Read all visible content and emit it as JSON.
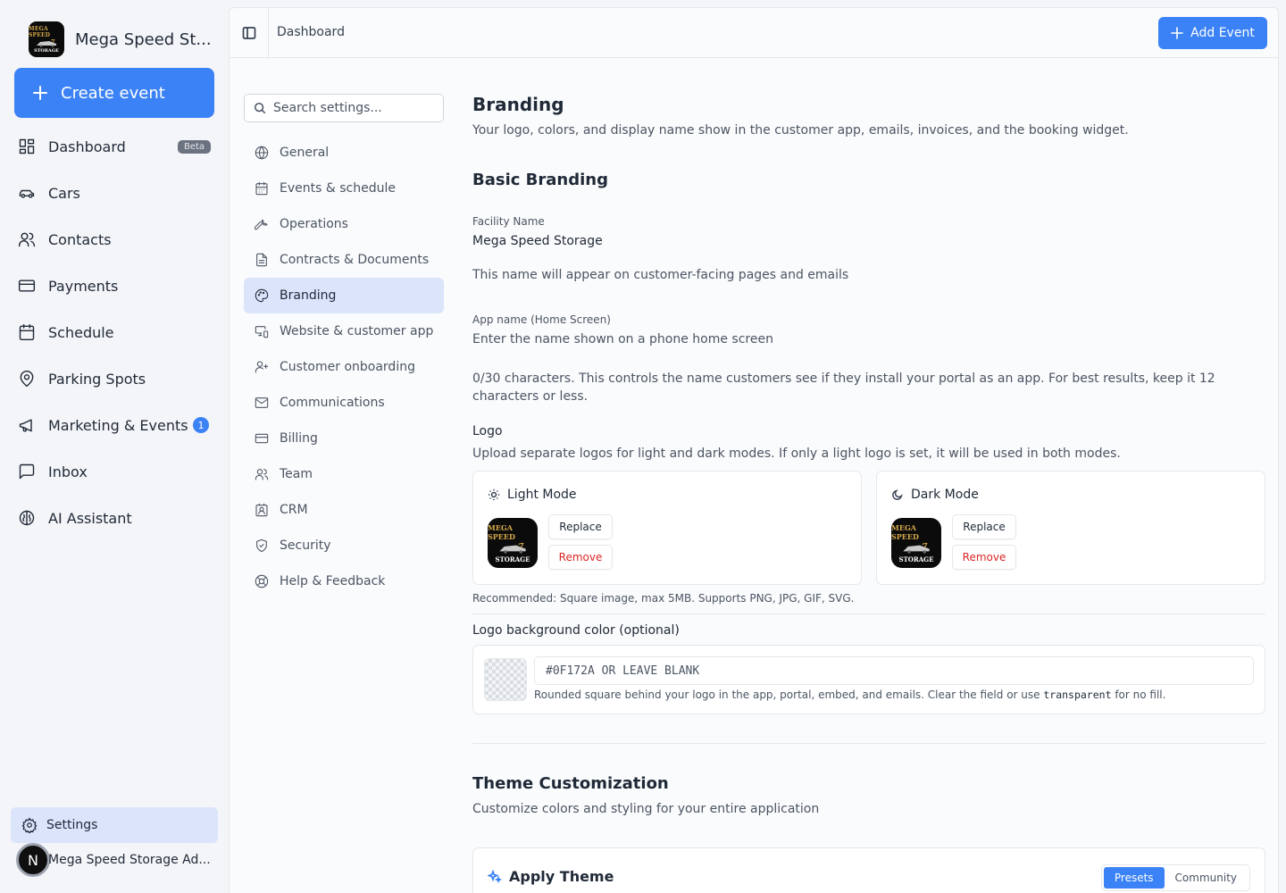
{
  "sidebar": {
    "brand_name": "Mega Speed St...",
    "logo_text_top": "MEGA SPEED",
    "logo_text_bottom": "STORAGE",
    "create_label": "Create event",
    "items": [
      {
        "label": "Dashboard",
        "icon": "layout-dashboard-icon",
        "badge": "Beta"
      },
      {
        "label": "Cars",
        "icon": "car-icon"
      },
      {
        "label": "Contacts",
        "icon": "users-icon"
      },
      {
        "label": "Payments",
        "icon": "credit-card-icon"
      },
      {
        "label": "Schedule",
        "icon": "calendar-icon"
      },
      {
        "label": "Parking Spots",
        "icon": "map-pin-icon"
      },
      {
        "label": "Marketing & Events",
        "icon": "megaphone-icon",
        "count": "1"
      },
      {
        "label": "Inbox",
        "icon": "message-square-icon"
      },
      {
        "label": "AI Assistant",
        "icon": "brain-icon"
      }
    ],
    "settings_label": "Settings",
    "user_initial": "N",
    "user_name": "Mega Speed Storage Ad..."
  },
  "topbar": {
    "breadcrumb": "Dashboard",
    "add_event_label": "Add Event"
  },
  "settings_nav": {
    "search_placeholder": "Search settings...",
    "items": [
      {
        "label": "General",
        "icon": "globe-icon"
      },
      {
        "label": "Events & schedule",
        "icon": "calendar-icon"
      },
      {
        "label": "Operations",
        "icon": "wrench-icon"
      },
      {
        "label": "Contracts & Documents",
        "icon": "file-text-icon"
      },
      {
        "label": "Branding",
        "icon": "palette-icon",
        "active": true
      },
      {
        "label": "Website & customer app",
        "icon": "monitor-smartphone-icon"
      },
      {
        "label": "Customer onboarding",
        "icon": "user-plus-icon"
      },
      {
        "label": "Communications",
        "icon": "mail-icon"
      },
      {
        "label": "Billing",
        "icon": "credit-card-icon"
      },
      {
        "label": "Team",
        "icon": "users-icon"
      },
      {
        "label": "CRM",
        "icon": "contact-icon"
      },
      {
        "label": "Security",
        "icon": "shield-icon"
      },
      {
        "label": "Help & Feedback",
        "icon": "life-buoy-icon"
      }
    ]
  },
  "content": {
    "title": "Branding",
    "subtitle": "Your logo, colors, and display name show in the customer app, emails, invoices, and the booking widget.",
    "basic_heading": "Basic Branding",
    "facility_label": "Facility Name",
    "facility_value": "Mega Speed Storage",
    "facility_help": "This name will appear on customer-facing pages and emails",
    "app_name_label": "App name (Home Screen)",
    "app_name_placeholder": "Enter the name shown on a phone home screen",
    "app_name_help": "0/30 characters. This controls the name customers see if they install your portal as an app. For best results, keep it 12 characters or less.",
    "logo_heading": "Logo",
    "logo_help": "Upload separate logos for light and dark modes. If only a light logo is set, it will be used in both modes.",
    "light_mode_label": "Light Mode",
    "dark_mode_label": "Dark Mode",
    "replace_label": "Replace",
    "remove_label": "Remove",
    "logo_recommend": "Recommended: Square image, max 5MB. Supports PNG, JPG, GIF, SVG.",
    "bg_color_label": "Logo background color (optional)",
    "bg_color_placeholder": "#0F172A OR LEAVE BLANK",
    "bg_help_pre": "Rounded square behind your logo in the app, portal, embed, and emails. Clear the field or use ",
    "bg_help_code": "transparent",
    "bg_help_post": " for no fill.",
    "theme_heading": "Theme Customization",
    "theme_sub": "Customize colors and styling for your entire application",
    "apply_theme_label": "Apply Theme",
    "presets_label": "Presets",
    "community_label": "Community"
  },
  "colors": {
    "accent": "#3b82f6",
    "active_bg": "#dbe4fb",
    "danger": "#dc2626"
  }
}
